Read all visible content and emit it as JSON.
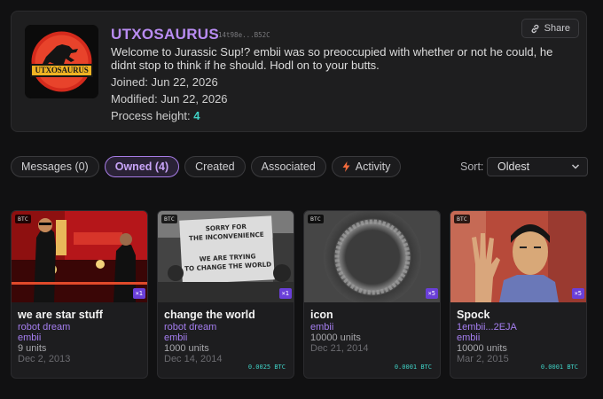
{
  "profile": {
    "username": "UTXOSAURUS",
    "address": "14t98e...B52C",
    "bio": "Welcome to Jurassic Sup!? embii was so preoccupied with whether or not he could, he didnt stop to think if he should. Hodl on to your butts.",
    "joined": "Joined: Jun 22, 2026",
    "modified": "Modified: Jun 22, 2026",
    "process_height_label": "Process height:",
    "process_height_value": "4",
    "logo_text": "UTXOSAURUS",
    "share_label": "Share"
  },
  "tabs": [
    {
      "label": "Messages (0)",
      "active": false
    },
    {
      "label": "Owned (4)",
      "active": true
    },
    {
      "label": "Created",
      "active": false
    },
    {
      "label": "Associated",
      "active": false
    },
    {
      "label": "Activity",
      "active": false
    }
  ],
  "sort": {
    "label": "Sort:",
    "value": "Oldest"
  },
  "cards": [
    {
      "chain": "BTC",
      "multiplier": "×1",
      "title": "we are star stuff",
      "collection": "robot dream",
      "creator": "embii",
      "units": "9 units",
      "date": "Dec 2, 2013",
      "price": ""
    },
    {
      "chain": "BTC",
      "multiplier": "×1",
      "title": "change the world",
      "collection": "robot dream",
      "creator": "embii",
      "units": "1000 units",
      "date": "Dec 14, 2014",
      "price": "0.0025 BTC",
      "sign_text": [
        "SORRY FOR",
        "THE INCONVENIENCE",
        "WE ARE TRYING",
        "TO CHANGE THE WORLD"
      ]
    },
    {
      "chain": "BTC",
      "multiplier": "×5",
      "title": "icon",
      "collection": "",
      "creator": "embii",
      "units": "10000 units",
      "date": "Dec 21, 2014",
      "price": "0.0001 BTC"
    },
    {
      "chain": "BTC",
      "multiplier": "×5",
      "title": "Spock",
      "collection": "1embii...2EJA",
      "creator": "embii",
      "units": "10000 units",
      "date": "Mar 2, 2015",
      "price": "0.0001 BTC"
    }
  ],
  "colors": {
    "accent": "#b98cf2",
    "teal": "#3fd0c4",
    "badge": "#6a3fd8",
    "bg": "#111112"
  }
}
